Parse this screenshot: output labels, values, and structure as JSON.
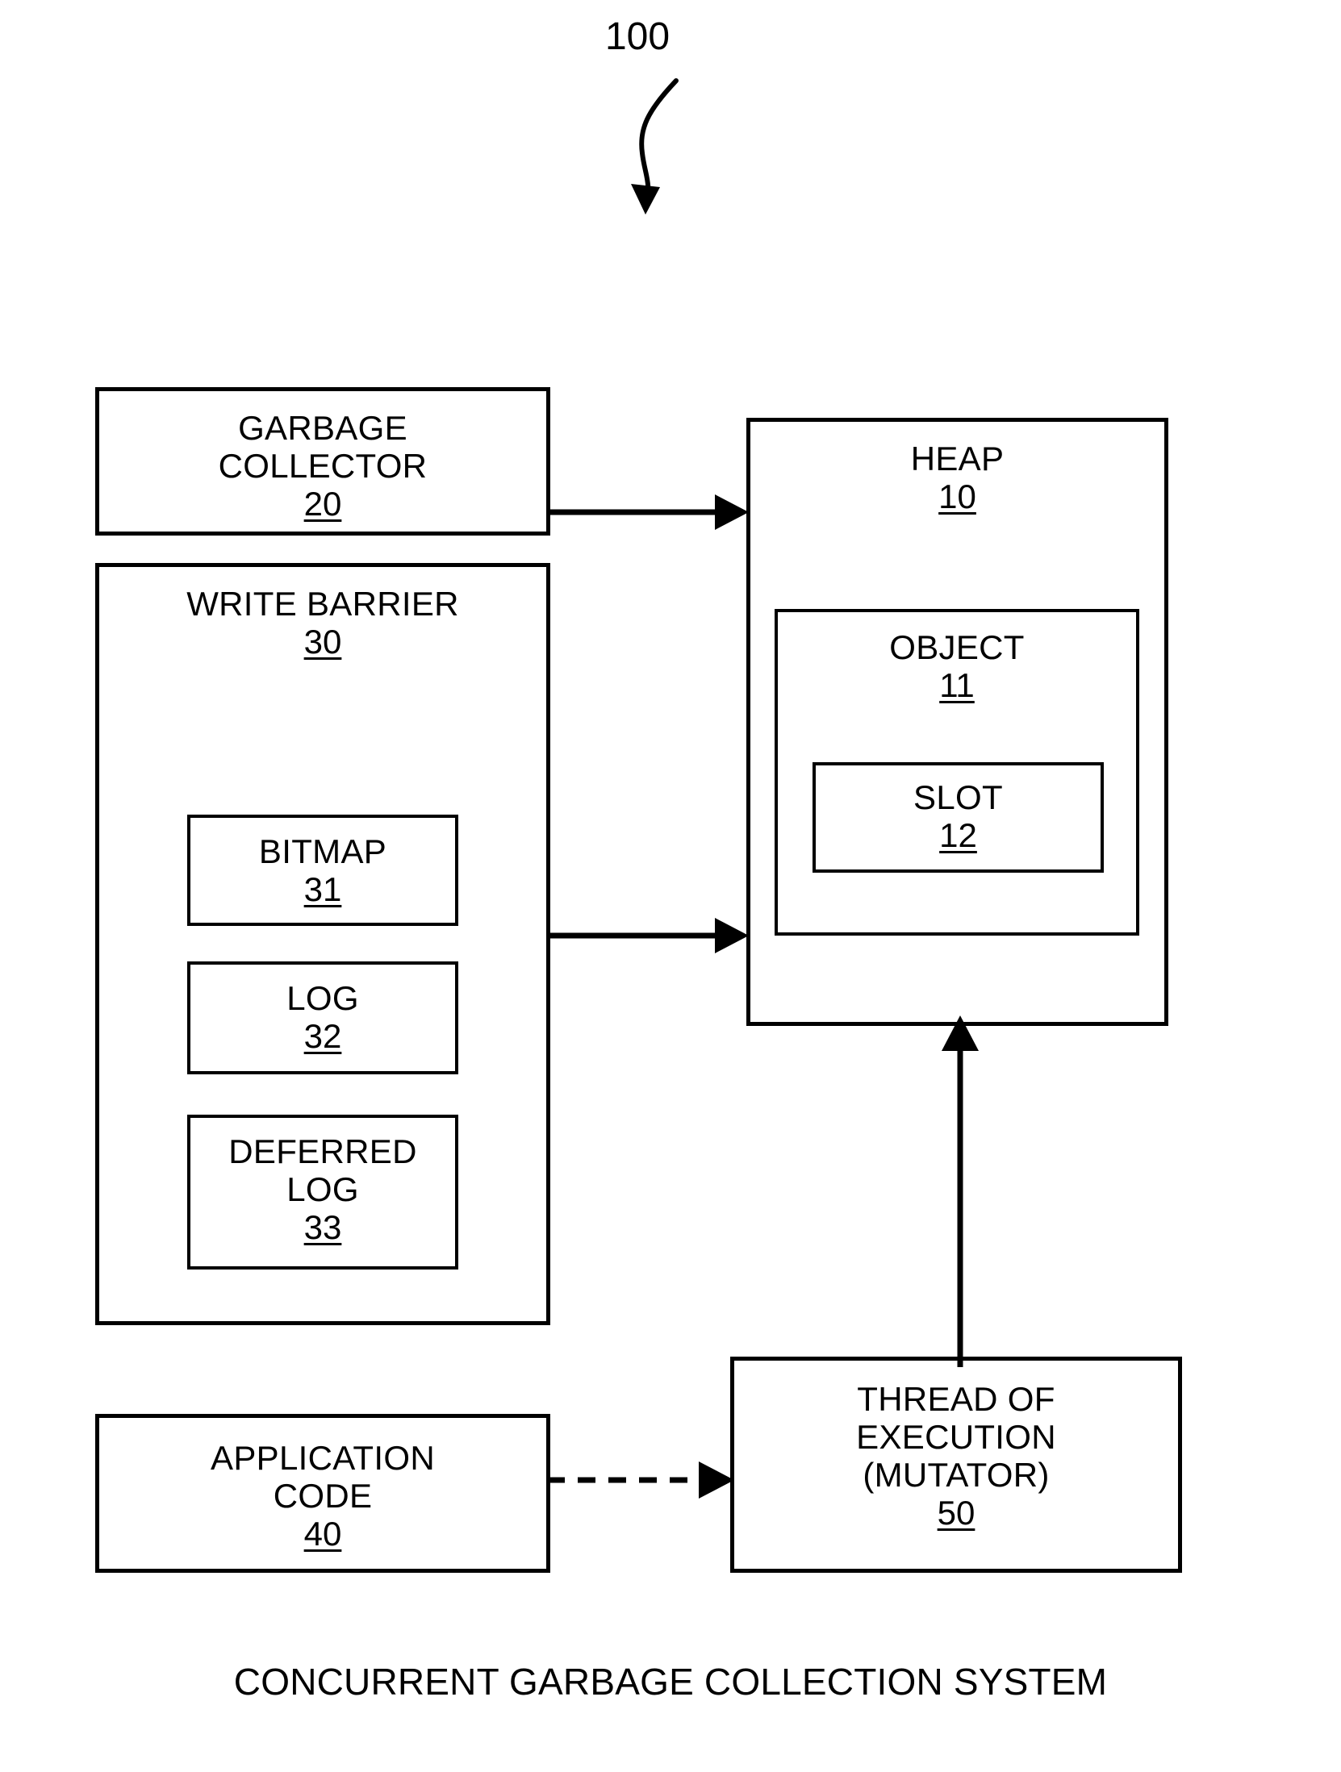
{
  "figure": {
    "reference_numeral": "100",
    "caption": "CONCURRENT GARBAGE COLLECTION SYSTEM"
  },
  "blocks": {
    "garbage_collector": {
      "label": "GARBAGE\nCOLLECTOR",
      "ref": "20"
    },
    "write_barrier": {
      "label": "WRITE BARRIER",
      "ref": "30"
    },
    "bitmap": {
      "label": "BITMAP",
      "ref": "31"
    },
    "log": {
      "label": "LOG",
      "ref": "32"
    },
    "deferred_log": {
      "label": "DEFERRED\nLOG",
      "ref": "33"
    },
    "application_code": {
      "label": "APPLICATION\nCODE",
      "ref": "40"
    },
    "heap": {
      "label": "HEAP",
      "ref": "10"
    },
    "object": {
      "label": "OBJECT",
      "ref": "11"
    },
    "slot": {
      "label": "SLOT",
      "ref": "12"
    },
    "thread": {
      "label": "THREAD OF\nEXECUTION\n(MUTATOR)",
      "ref": "50"
    }
  },
  "connectors": {
    "gc_to_heap": {
      "style": "solid",
      "direction": "right"
    },
    "wb_to_heap": {
      "style": "solid",
      "direction": "right"
    },
    "app_to_thread": {
      "style": "dashed",
      "direction": "right"
    },
    "thread_to_heap": {
      "style": "solid",
      "direction": "up"
    },
    "reference_leader": {
      "style": "curved",
      "direction": "down"
    }
  },
  "colors": {
    "stroke": "#000000",
    "background": "#ffffff"
  }
}
